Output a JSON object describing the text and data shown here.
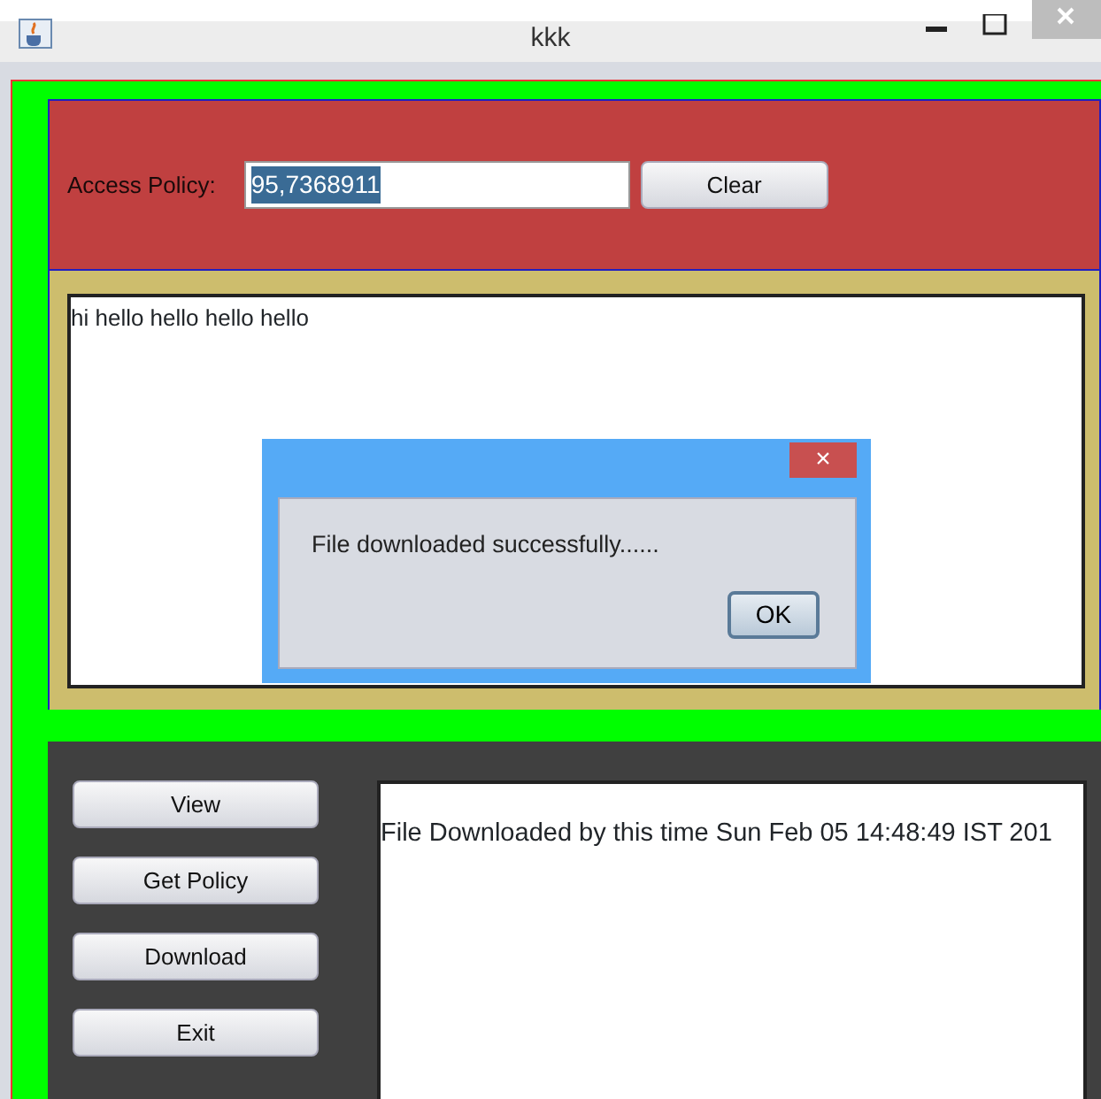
{
  "window": {
    "title": "kkk"
  },
  "access_policy": {
    "label": "Access Policy:",
    "value": "95,7368911",
    "value_selected": true,
    "clear_button": "Clear"
  },
  "message_area": {
    "text": "hi hello hello hello hello"
  },
  "dialog": {
    "message": "File downloaded successfully......",
    "ok_button": "OK",
    "close_button": "×"
  },
  "buttons": [
    {
      "label": "View"
    },
    {
      "label": "Get Policy"
    },
    {
      "label": "Download"
    },
    {
      "label": "Exit"
    }
  ],
  "log_area": {
    "text": "File Downloaded by this time Sun Feb 05 14:48:49 IST 201"
  }
}
